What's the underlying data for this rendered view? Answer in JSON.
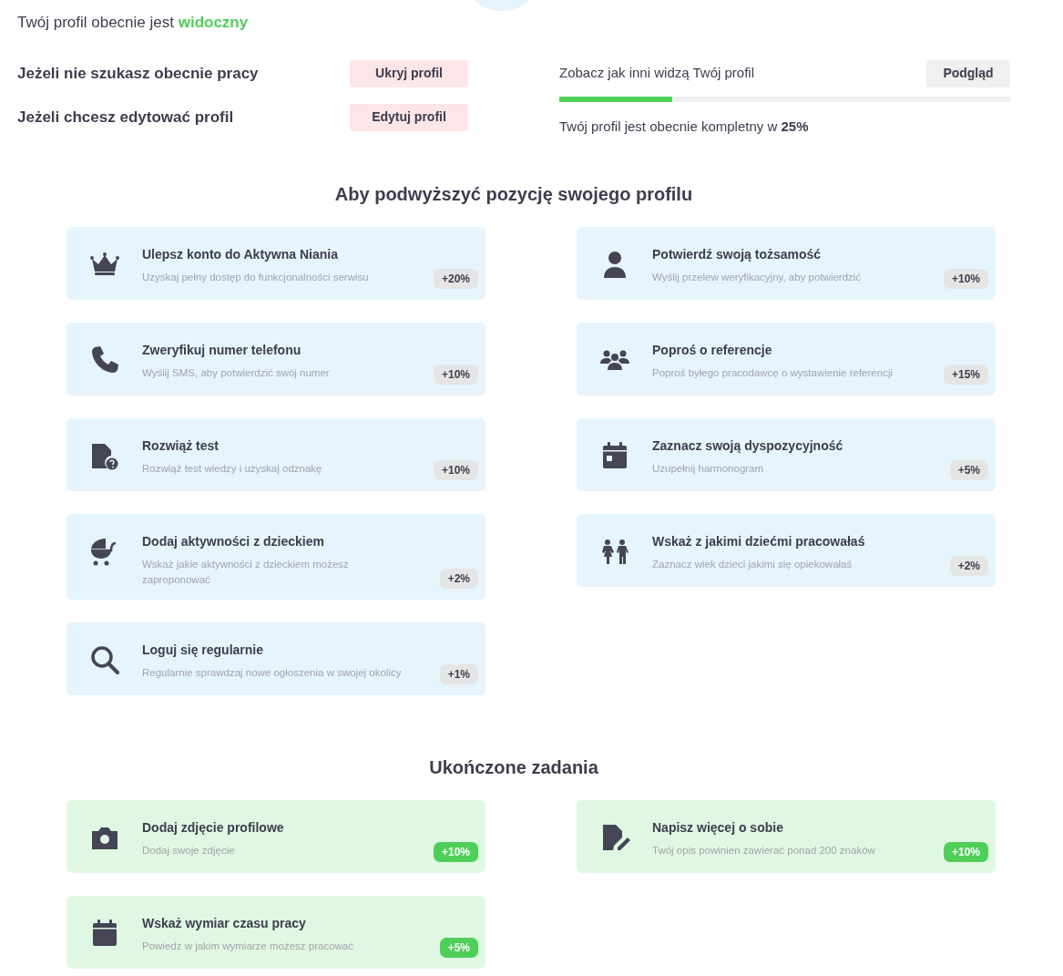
{
  "visibility": {
    "text": "Twój profil obecnie jest **widoczny**",
    "visible": true
  },
  "actions": [
    {
      "label": "Jeżeli nie szukasz obecnie pracy",
      "button": "Ukryj profil"
    },
    {
      "label": "Jeżeli chcesz edytować profil",
      "button": "Edytuj profil"
    }
  ],
  "preview": {
    "label": "Zobacz jak inni widzą Twój profil",
    "button": "Podgląd"
  },
  "completeness": {
    "level": 0.25,
    "text": "Twój profil jest obecnie kompletny w **25%**"
  },
  "sections": [
    {
      "title": "Aby podwyższyć pozycję swojego profilu",
      "completed": false,
      "tasks": [
        {
          "title": "Ulepsz konto do Aktywna Niania",
          "description": "Uzyskaj pełny dostęp do funkcjonalności serwisu",
          "points": "+20%"
        },
        {
          "title": "Potwierdź swoją tożsamość",
          "description": "Wyślij przelew weryfikacyjny, aby potwierdzić",
          "points": "+10%"
        },
        {
          "title": "Zweryfikuj numer telefonu",
          "description": "Wyślij SMS, aby potwierdzić swój numer",
          "points": "+10%"
        },
        {
          "title": "Poproś o referencje",
          "description": "Poproś byłego pracodawcę o wystawienie referencji",
          "points": "+15%"
        },
        {
          "title": "Rozwiąż test",
          "description": "Rozwiąż test wiedzy i uzyskaj odznakę",
          "points": "+10%"
        },
        {
          "title": "Zaznacz swoją dyspozycyjność",
          "description": "Uzupełnij harmonogram",
          "points": "+5%"
        },
        {
          "title": "Dodaj aktywności z dzieckiem",
          "description": "Wskaż jakie aktywności z dzieckiem możesz zaproponować",
          "points": "+2%"
        },
        {
          "title": "Wskaż z jakimi dziećmi pracowałaś",
          "description": "Zaznacz wiek dzieci jakimi się opiekowałaś",
          "points": "+2%"
        },
        {
          "title": "Loguj się regularnie",
          "description": "Regularnie sprawdzaj nowe ogłoszenia w swojej okolicy",
          "points": "+1%"
        }
      ]
    },
    {
      "title": "Ukończone zadania",
      "completed": true,
      "tasks": [
        {
          "title": "Dodaj zdjęcie profilowe",
          "description": "Dodaj swoje zdjęcie",
          "points": "+10%"
        },
        {
          "title": "Napisz więcej o sobie",
          "description": "Twój opis powinien zawierać ponad 200 znaków",
          "points": "+10%"
        },
        {
          "title": "Wskaż wymiar czasu pracy",
          "description": "Powiedz w jakim wymiarze możesz pracować",
          "points": "+5%"
        }
      ]
    }
  ]
}
